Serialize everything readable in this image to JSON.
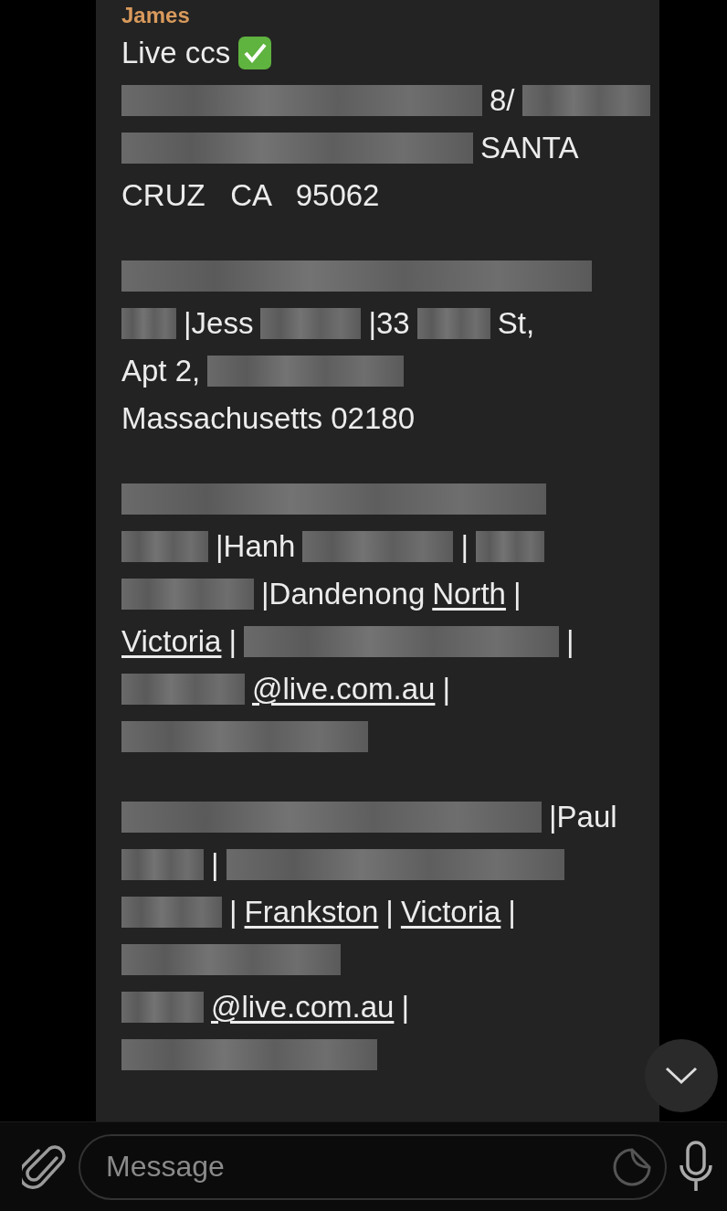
{
  "message": {
    "sender": "James",
    "paragraphs": [
      {
        "lines": [
          [
            {
              "kind": "text",
              "text": "Live ccs"
            },
            {
              "kind": "check"
            }
          ],
          [
            {
              "kind": "redacted"
            },
            {
              "kind": "text",
              "text": "8/"
            },
            {
              "kind": "redacted"
            }
          ],
          [
            {
              "kind": "redacted"
            },
            {
              "kind": "text",
              "text": "SANTA"
            }
          ],
          [
            {
              "kind": "text",
              "text": "CRUZ   CA   95062"
            }
          ]
        ]
      },
      {
        "lines": [
          [
            {
              "kind": "redacted"
            }
          ],
          [
            {
              "kind": "redacted"
            },
            {
              "kind": "text",
              "text": "|Jess"
            },
            {
              "kind": "redacted"
            },
            {
              "kind": "text",
              "text": "|33"
            },
            {
              "kind": "redacted"
            },
            {
              "kind": "text",
              "text": "St,"
            }
          ],
          [
            {
              "kind": "text",
              "text": "Apt 2,"
            },
            {
              "kind": "redacted"
            }
          ],
          [
            {
              "kind": "text",
              "text": "Massachusetts 02180"
            }
          ]
        ]
      },
      {
        "lines": [
          [
            {
              "kind": "redacted"
            }
          ],
          [
            {
              "kind": "redacted"
            },
            {
              "kind": "text",
              "text": "|Hanh"
            },
            {
              "kind": "redacted"
            },
            {
              "kind": "text",
              "text": "|"
            },
            {
              "kind": "redacted"
            }
          ],
          [
            {
              "kind": "redacted"
            },
            {
              "kind": "text",
              "text": "|Dandenong"
            },
            {
              "kind": "link",
              "text": "North"
            },
            {
              "kind": "text",
              "text": "|"
            }
          ],
          [
            {
              "kind": "link",
              "text": "Victoria"
            },
            {
              "kind": "text",
              "text": "|"
            },
            {
              "kind": "redacted"
            },
            {
              "kind": "text",
              "text": "|"
            }
          ],
          [
            {
              "kind": "redacted"
            },
            {
              "kind": "link",
              "text": "@live.com.au"
            },
            {
              "kind": "text",
              "text": "|"
            }
          ],
          [
            {
              "kind": "redacted"
            }
          ]
        ]
      },
      {
        "lines": [
          [
            {
              "kind": "redacted"
            },
            {
              "kind": "text",
              "text": "|Paul"
            }
          ],
          [
            {
              "kind": "redacted"
            },
            {
              "kind": "text",
              "text": "|"
            },
            {
              "kind": "redacted"
            }
          ],
          [
            {
              "kind": "redacted"
            },
            {
              "kind": "text",
              "text": "|"
            },
            {
              "kind": "link",
              "text": "Frankston"
            },
            {
              "kind": "text",
              "text": "|"
            },
            {
              "kind": "link",
              "text": "Victoria"
            },
            {
              "kind": "text",
              "text": "|"
            }
          ],
          [
            {
              "kind": "redacted"
            }
          ],
          [
            {
              "kind": "redacted"
            },
            {
              "kind": "link",
              "text": "@live.com.au"
            },
            {
              "kind": "text",
              "text": "|"
            }
          ],
          [
            {
              "kind": "redacted"
            }
          ]
        ]
      }
    ]
  },
  "composer": {
    "placeholder": "Message"
  }
}
